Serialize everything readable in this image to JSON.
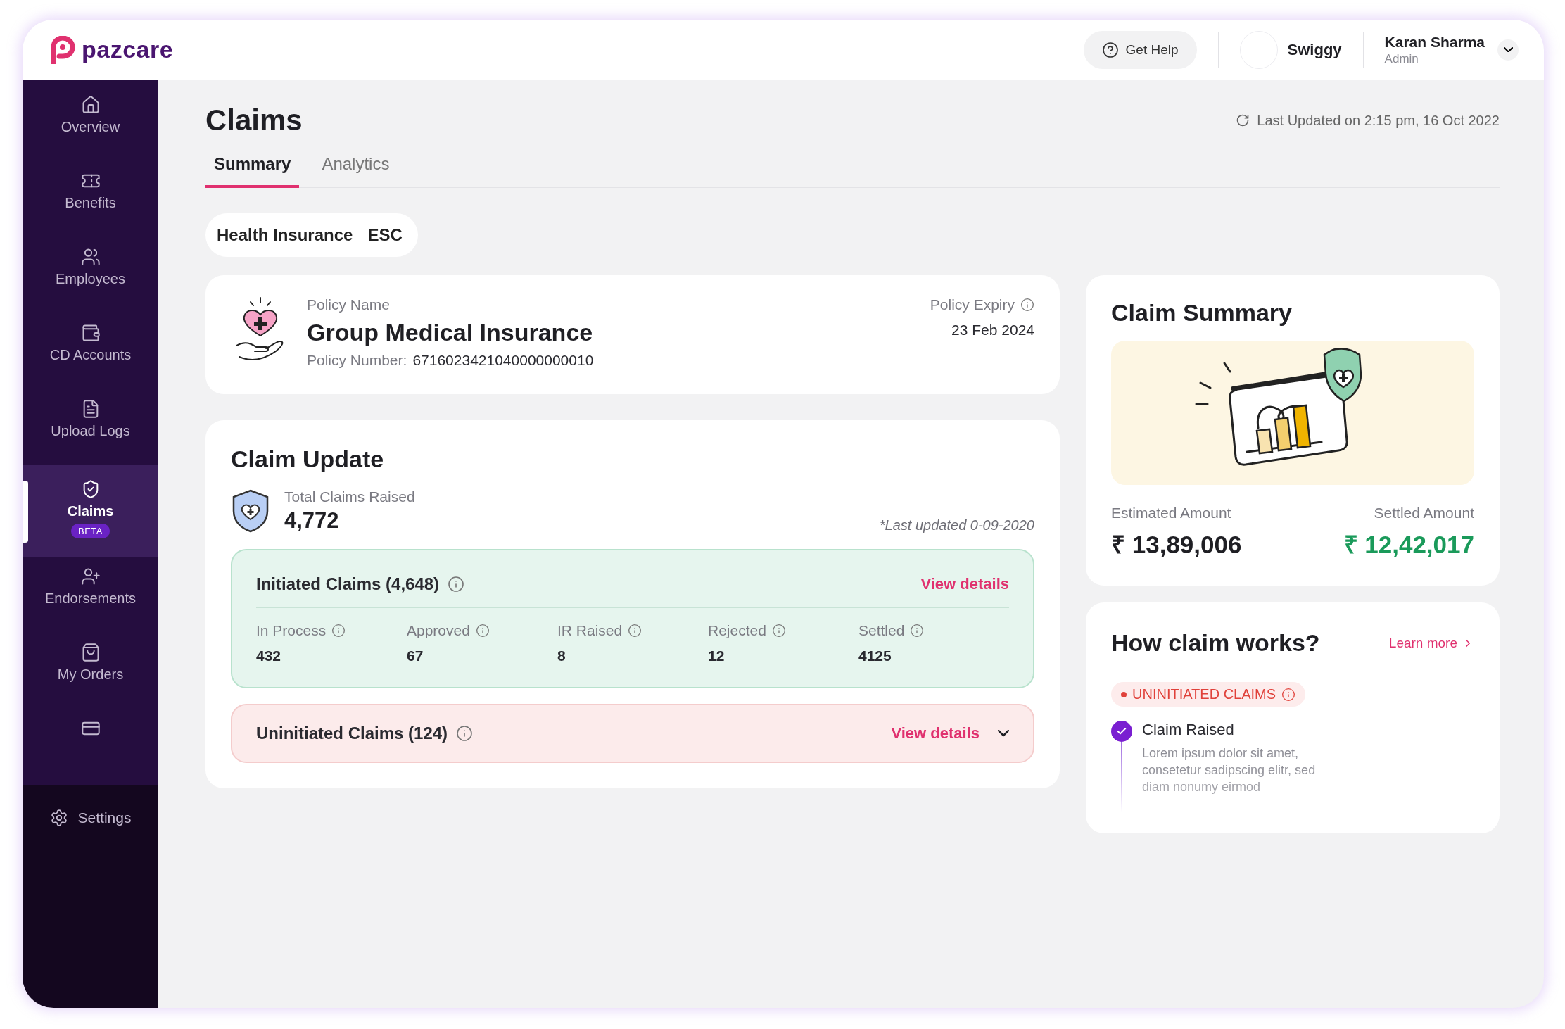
{
  "brand": {
    "name": "pazcare"
  },
  "header": {
    "help_button": "Get Help",
    "company": "Swiggy",
    "user": {
      "name": "Karan Sharma",
      "role": "Admin"
    }
  },
  "sidebar": {
    "items": [
      {
        "label": "Overview",
        "selected": false
      },
      {
        "label": "Benefits",
        "selected": false
      },
      {
        "label": "Employees",
        "selected": false
      },
      {
        "label": "CD Accounts",
        "selected": false
      },
      {
        "label": "Upload Logs",
        "selected": false
      },
      {
        "label": "Claims",
        "badge": "BETA",
        "selected": true
      },
      {
        "label": "Endorsements",
        "selected": false
      },
      {
        "label": "My Orders",
        "selected": false
      },
      {
        "selected": false
      }
    ],
    "settings": "Settings"
  },
  "page": {
    "title": "Claims",
    "last_updated": "Last Updated on 2:15 pm, 16 Oct 2022",
    "tabs": [
      {
        "label": "Summary",
        "selected": true
      },
      {
        "label": "Analytics",
        "selected": false
      }
    ],
    "policy_filter": [
      "Health Insurance",
      "ESC"
    ]
  },
  "policy_card": {
    "name_label": "Policy Name",
    "name": "Group Medical Insurance",
    "number_label": "Policy Number:",
    "number": "6716023421040000000010",
    "expiry_label": "Policy Expiry",
    "expiry": "23 Feb 2024"
  },
  "claim_update": {
    "title": "Claim Update",
    "total_label": "Total Claims Raised",
    "total": "4,772",
    "note": "*Last updated 0-09-2020",
    "initiated": {
      "title": "Initiated Claims (4,648)",
      "link": "View details",
      "stats": [
        {
          "label": "In Process",
          "value": "432"
        },
        {
          "label": "Approved",
          "value": "67"
        },
        {
          "label": "IR Raised",
          "value": "8"
        },
        {
          "label": "Rejected",
          "value": "12"
        },
        {
          "label": "Settled",
          "value": "4125"
        }
      ]
    },
    "uninitiated": {
      "title": "Uninitiated Claims (124)",
      "link": "View details",
      "expanded": false
    }
  },
  "claim_summary": {
    "title": "Claim Summary",
    "estimated_label": "Estimated Amount",
    "estimated": "₹ 13,89,006",
    "settled_label": "Settled Amount",
    "settled": "₹ 12,42,017"
  },
  "how_claim_works": {
    "title": "How claim works?",
    "link": "Learn more",
    "tag": "UNINITIATED CLAIMS",
    "steps": [
      {
        "title": "Claim Raised",
        "description": "Lorem ipsum dolor sit amet, consetetur sadipscing elitr, sed diam nonumy eirmod",
        "checked": true
      }
    ]
  }
}
